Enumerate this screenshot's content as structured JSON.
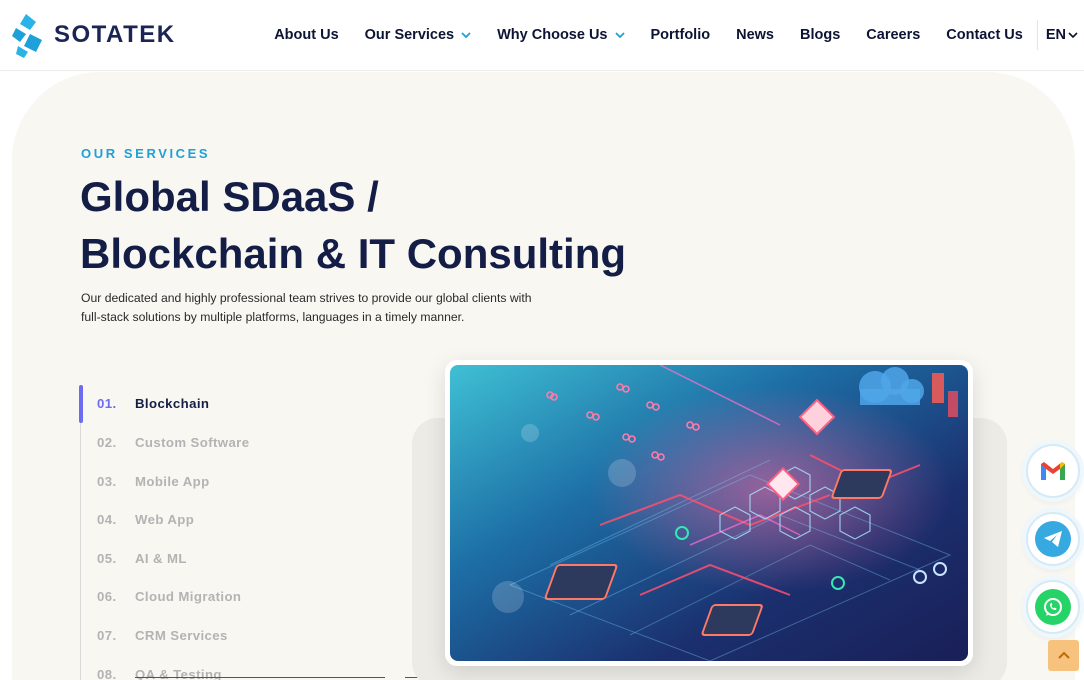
{
  "brand": {
    "name": "SOTATEK",
    "logo_colors": [
      "#1ea0d8",
      "#2ab3e6"
    ]
  },
  "nav": {
    "items": [
      {
        "label": "About Us",
        "dropdown": false
      },
      {
        "label": "Our Services",
        "dropdown": true
      },
      {
        "label": "Why Choose Us",
        "dropdown": true
      },
      {
        "label": "Portfolio",
        "dropdown": false
      },
      {
        "label": "News",
        "dropdown": false
      },
      {
        "label": "Blogs",
        "dropdown": false
      },
      {
        "label": "Careers",
        "dropdown": false
      },
      {
        "label": "Contact Us",
        "dropdown": false
      }
    ],
    "language": "EN",
    "chevron_icon": "chevron-down-icon",
    "accent": "#1ea0d8"
  },
  "hero": {
    "eyebrow": "OUR SERVICES",
    "title_line1": "Global SDaaS /",
    "title_line2": "Blockchain & IT Consulting",
    "description_line1": "Our dedicated and highly professional team strives to provide our global clients with",
    "description_line2": "full-stack solutions by multiple platforms, languages in a timely manner."
  },
  "services": {
    "active_index": 0,
    "active_color": "#6b6cf1",
    "items": [
      {
        "num": "01.",
        "label": "Blockchain"
      },
      {
        "num": "02.",
        "label": "Custom Software"
      },
      {
        "num": "03.",
        "label": "Mobile App"
      },
      {
        "num": "04.",
        "label": "Web App"
      },
      {
        "num": "05.",
        "label": "AI & ML"
      },
      {
        "num": "06.",
        "label": "Cloud Migration"
      },
      {
        "num": "07.",
        "label": "CRM Services"
      },
      {
        "num": "08.",
        "label": "QA & Testing"
      }
    ]
  },
  "feature_image": {
    "subject": "blockchain-circuit-illustration"
  },
  "contact_buttons": [
    {
      "icon": "gmail-icon"
    },
    {
      "icon": "telegram-icon"
    },
    {
      "icon": "whatsapp-icon"
    }
  ],
  "scroll_top": {
    "icon": "chevron-up-icon",
    "color": "#f6c27e"
  }
}
